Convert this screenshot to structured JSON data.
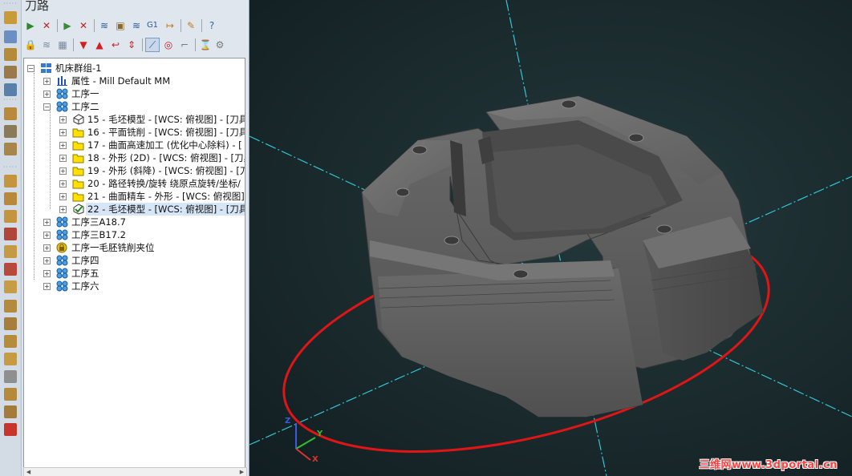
{
  "panel": {
    "title": "刀路"
  },
  "toolbar": {
    "g1_label": "G1"
  },
  "tree": {
    "items": [
      {
        "label": "机床群组-1",
        "level": 0,
        "icon": "machine-group-icon"
      },
      {
        "label": "属性 - Mill Default MM",
        "level": 1,
        "icon": "properties-icon"
      },
      {
        "label": "工序一",
        "level": 1,
        "icon": "operation-group-icon"
      },
      {
        "label": "工序二",
        "level": 1,
        "icon": "operation-group-icon"
      },
      {
        "label": "15 - 毛坯模型 - [WCS: 俯视图] - [刀具",
        "level": 2,
        "icon": "stock-model-icon"
      },
      {
        "label": "16 - 平面铣削 - [WCS: 俯视图] - [刀具",
        "level": 2,
        "icon": "folder-icon"
      },
      {
        "label": "17 - 曲面高速加工 (优化中心除料) - [",
        "level": 2,
        "icon": "folder-icon"
      },
      {
        "label": "18 - 外形 (2D) - [WCS: 俯视图] - [刀具",
        "level": 2,
        "icon": "folder-icon"
      },
      {
        "label": "19 - 外形 (斜降) - [WCS: 俯视图] - [刀",
        "level": 2,
        "icon": "folder-icon"
      },
      {
        "label": "20 - 路径转换/旋转 绕原点旋转/坐标/",
        "level": 2,
        "icon": "folder-icon"
      },
      {
        "label": "21 - 曲面精车 - 外形 - [WCS: 俯视图]",
        "level": 2,
        "icon": "folder-icon"
      },
      {
        "label": "22 - 毛坯模型 - [WCS: 俯视图] - [刀具",
        "level": 2,
        "icon": "stock-model-checked-icon",
        "selected": true
      },
      {
        "label": "工序三A18.7",
        "level": 1,
        "icon": "operation-group-icon"
      },
      {
        "label": "工序三B17.2",
        "level": 1,
        "icon": "operation-group-icon"
      },
      {
        "label": "工序一毛胚铣削夹位",
        "level": 1,
        "icon": "locked-group-icon"
      },
      {
        "label": "工序四",
        "level": 1,
        "icon": "operation-group-icon"
      },
      {
        "label": "工序五",
        "level": 1,
        "icon": "operation-group-icon"
      },
      {
        "label": "工序六",
        "level": 1,
        "icon": "operation-group-icon"
      }
    ]
  },
  "viewport": {
    "axis_x": "X",
    "axis_y": "Y",
    "axis_z": "Z",
    "watermark": "三维网www.3dportal.cn"
  },
  "colors": {
    "background": "#1a2a2d",
    "guide_lines": "#2ec7d6",
    "stock_circle": "#e01515",
    "part": "#5a5a5a",
    "selection": "#d6e6f7"
  }
}
